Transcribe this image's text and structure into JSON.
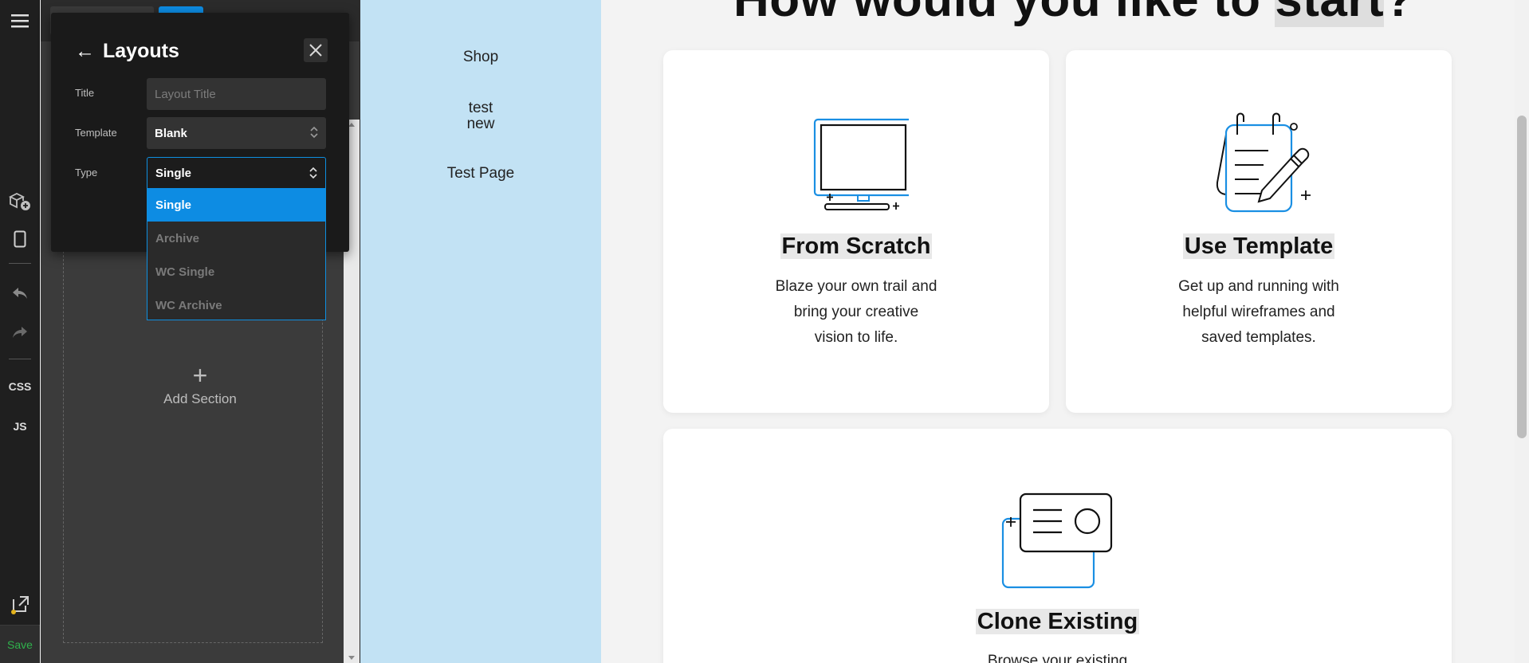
{
  "toolbar": {
    "css_label": "CSS",
    "js_label": "JS",
    "save_label": "Save",
    "icons": [
      "menu-icon",
      "add-module-icon",
      "mobile-preview-icon",
      "undo-icon",
      "redo-icon",
      "external-link-icon"
    ]
  },
  "panel": {
    "add_section_plus": "+",
    "add_section_label": "Add Section"
  },
  "modal": {
    "back_arrow": "←",
    "title": "Layouts",
    "fields": {
      "title_label": "Title",
      "title_placeholder": "Layout Title",
      "template_label": "Template",
      "template_value": "Blank",
      "type_label": "Type",
      "type_value": "Single"
    },
    "type_options": [
      "Single",
      "Archive",
      "WC Single",
      "WC Archive"
    ],
    "selected_option": "Single",
    "accent_color": "#0d8ce3"
  },
  "nav": {
    "items": [
      "Shop",
      "test\nnew",
      "Test Page"
    ],
    "background": "#c2e2f4"
  },
  "canvas": {
    "heading_visible": "How would you like to ",
    "heading_highlight": "start",
    "heading_end": "?",
    "cards": [
      {
        "icon": "monitor-icon",
        "title": "From Scratch",
        "desc_lines": [
          "Blaze your own trail and",
          "bring your creative",
          "vision to life."
        ]
      },
      {
        "icon": "notepad-pen-icon",
        "title": "Use Template",
        "desc_lines": [
          "Get up and running with",
          "helpful wireframes and",
          "saved templates."
        ]
      },
      {
        "icon": "clone-card-icon",
        "title": "Clone Existing",
        "desc_lines": [
          "Browse your existing"
        ]
      }
    ],
    "icon_accent_color": "#1a8fe3"
  }
}
